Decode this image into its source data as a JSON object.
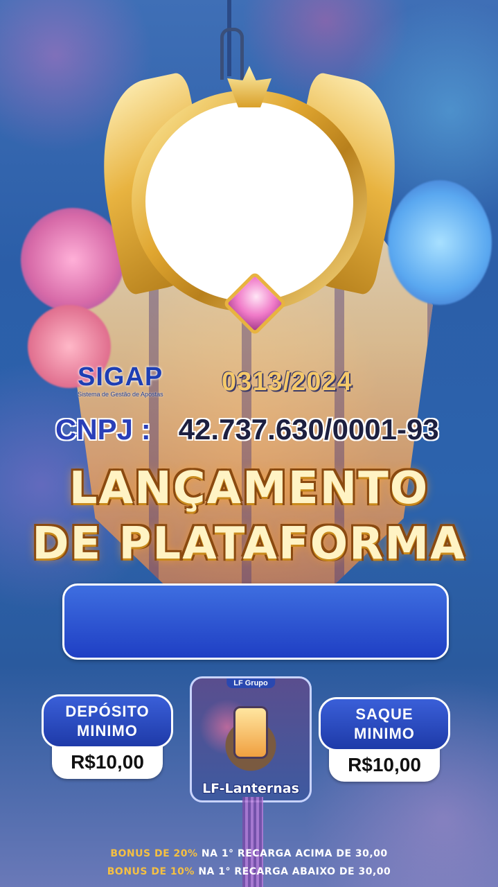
{
  "logo": {
    "name": "SIGAP",
    "subtitle": "Sistema de Gestão de Apostas"
  },
  "date": "0313/2024",
  "cnpj": {
    "label": "CNPJ :",
    "number": "42.737.630/0001-93"
  },
  "headline": {
    "line1": "LANÇAMENTO",
    "line2": "DE PLATAFORMA"
  },
  "deposit": {
    "label_line1": "DEPÓSITO",
    "label_line2": "MINIMO",
    "value": "R$10,00"
  },
  "withdraw": {
    "label_line1": "SAQUE",
    "label_line2": "MINIMO",
    "value": "R$10,00"
  },
  "game_card": {
    "tag": "LF Grupo",
    "name": "LF-Lanternas"
  },
  "bonus": [
    {
      "highlight": "BONUS DE 20%",
      "text": "NA 1° RECARGA ACIMA DE 30,00"
    },
    {
      "highlight": "BONUS DE 10%",
      "text": "NA 1° RECARGA ABAIXO DE 30,00"
    }
  ],
  "colors": {
    "accent_gold": "#f5c042",
    "brand_blue": "#1e3fb4",
    "box_blue": "#2a52d0"
  },
  "icons": {
    "logo": "sigap-logo",
    "frame": "golden-winged-frame",
    "card_image": "lantern-icon"
  }
}
